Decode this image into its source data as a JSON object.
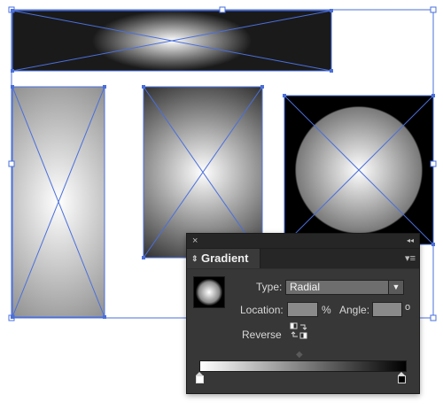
{
  "panel": {
    "close_icon": "×",
    "collapse_icon": "◂◂",
    "tab_arrows": "⇕",
    "tab_label": "Gradient",
    "menu_icon": "▾≡",
    "type_label": "Type:",
    "type_value": "Radial",
    "type_dropdown_icon": "▼",
    "location_label": "Location:",
    "location_value": "",
    "location_unit": "%",
    "angle_label": "Angle:",
    "angle_value": "",
    "angle_unit": "o",
    "reverse_label": "Reverse",
    "gradient_stops": [
      {
        "color": "#ffffff"
      },
      {
        "color": "#000000"
      }
    ]
  },
  "colors": {
    "selection": "#4a6fdc",
    "panel_bg": "#373737",
    "panel_dark": "#262626"
  }
}
